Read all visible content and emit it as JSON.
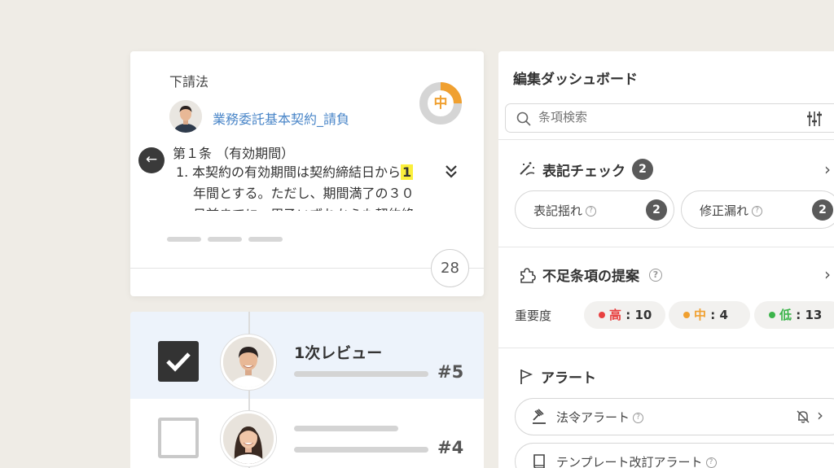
{
  "contract": {
    "law_label": "下請法",
    "doc_title": "業務委託基本契約_請負",
    "risk_level": "中",
    "risk_fraction": 0.25,
    "article_heading": "第１条 （有効期間）",
    "clause_number": "1.",
    "clause_line1_before": "本契約の有効期間は契約締結日から",
    "clause_highlight": "1",
    "clause_line2": "年間とする。ただし、期間満了の３０",
    "clause_line3": "日前までに、甲乙いずれからも契約終",
    "page_count": "28"
  },
  "reviews": [
    {
      "title": "1次レビュー",
      "number": "#5",
      "checked": true
    },
    {
      "title": "",
      "number": "#4",
      "checked": false
    }
  ],
  "dashboard": {
    "title": "編集ダッシュボード",
    "search_placeholder": "条項検索",
    "notation": {
      "title": "表記チェック",
      "count": "2",
      "items": [
        {
          "label": "表記揺れ",
          "count": "2"
        },
        {
          "label": "修正漏れ",
          "count": "2"
        }
      ]
    },
    "missing": {
      "title": "不足条項の提案",
      "importance_label": "重要度",
      "levels": [
        {
          "label": "高",
          "value": "10",
          "color": "#e84040"
        },
        {
          "label": "中",
          "value": "4",
          "color": "#f0a030"
        },
        {
          "label": "低",
          "value": "13",
          "color": "#3cb44b"
        }
      ]
    },
    "alerts": {
      "title": "アラート",
      "items": [
        {
          "label": "法令アラート"
        },
        {
          "label": "テンプレート改訂アラート"
        }
      ]
    }
  },
  "colors": {
    "accent_blue": "#4a86c8",
    "highlight_yellow": "#fbef3c",
    "active_row": "#edf3fb",
    "medium_orange": "#f0a030"
  }
}
